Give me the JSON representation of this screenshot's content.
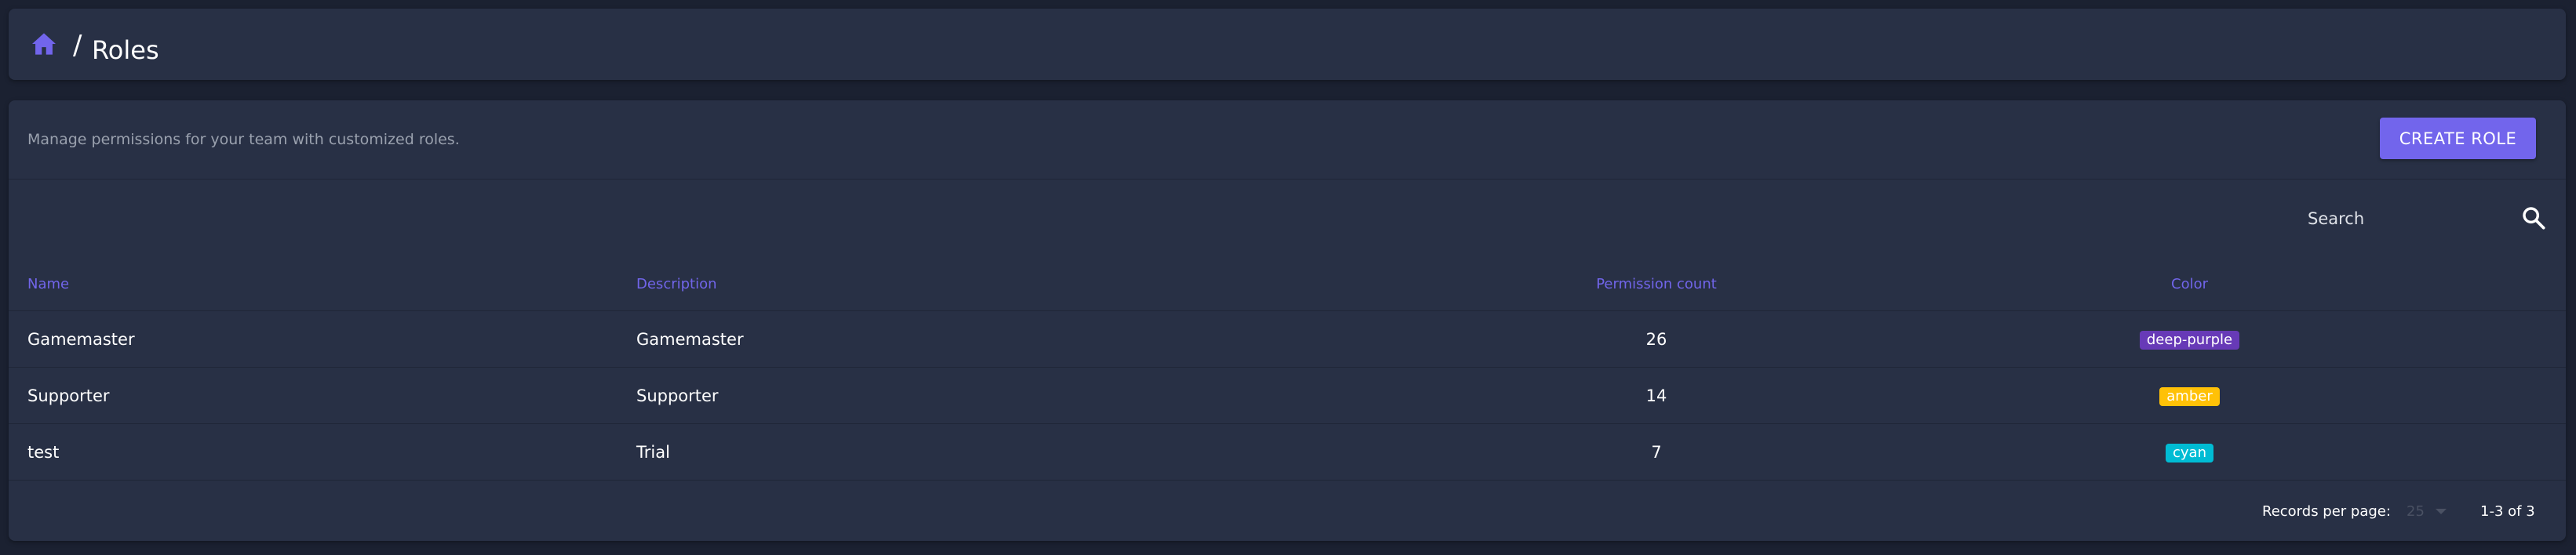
{
  "breadcrumb": {
    "home_icon": "home-icon",
    "separator": "/",
    "title": "Roles"
  },
  "toolbar": {
    "subtitle": "Manage permissions for your team with customized roles.",
    "create_label": "CREATE ROLE"
  },
  "search": {
    "placeholder": "Search",
    "icon": "search-icon"
  },
  "table": {
    "columns": [
      "Name",
      "Description",
      "Permission count",
      "Color"
    ],
    "rows": [
      {
        "name": "Gamemaster",
        "description": "Gamemaster",
        "permission_count": "26",
        "color": "deep-purple",
        "chip_bg": "#673ab7"
      },
      {
        "name": "Supporter",
        "description": "Supporter",
        "permission_count": "14",
        "color": "amber",
        "chip_bg": "#ffc107"
      },
      {
        "name": "test",
        "description": "Trial",
        "permission_count": "7",
        "color": "cyan",
        "chip_bg": "#00bcd4"
      }
    ]
  },
  "pagination": {
    "rows_per_page_label": "Records per page:",
    "rows_per_page_value": "25",
    "range": "1-3 of 3"
  },
  "colors": {
    "accent": "#7265ec",
    "card_bg": "#283045",
    "page_bg": "#1b2131",
    "header_text": "#7165ea"
  }
}
